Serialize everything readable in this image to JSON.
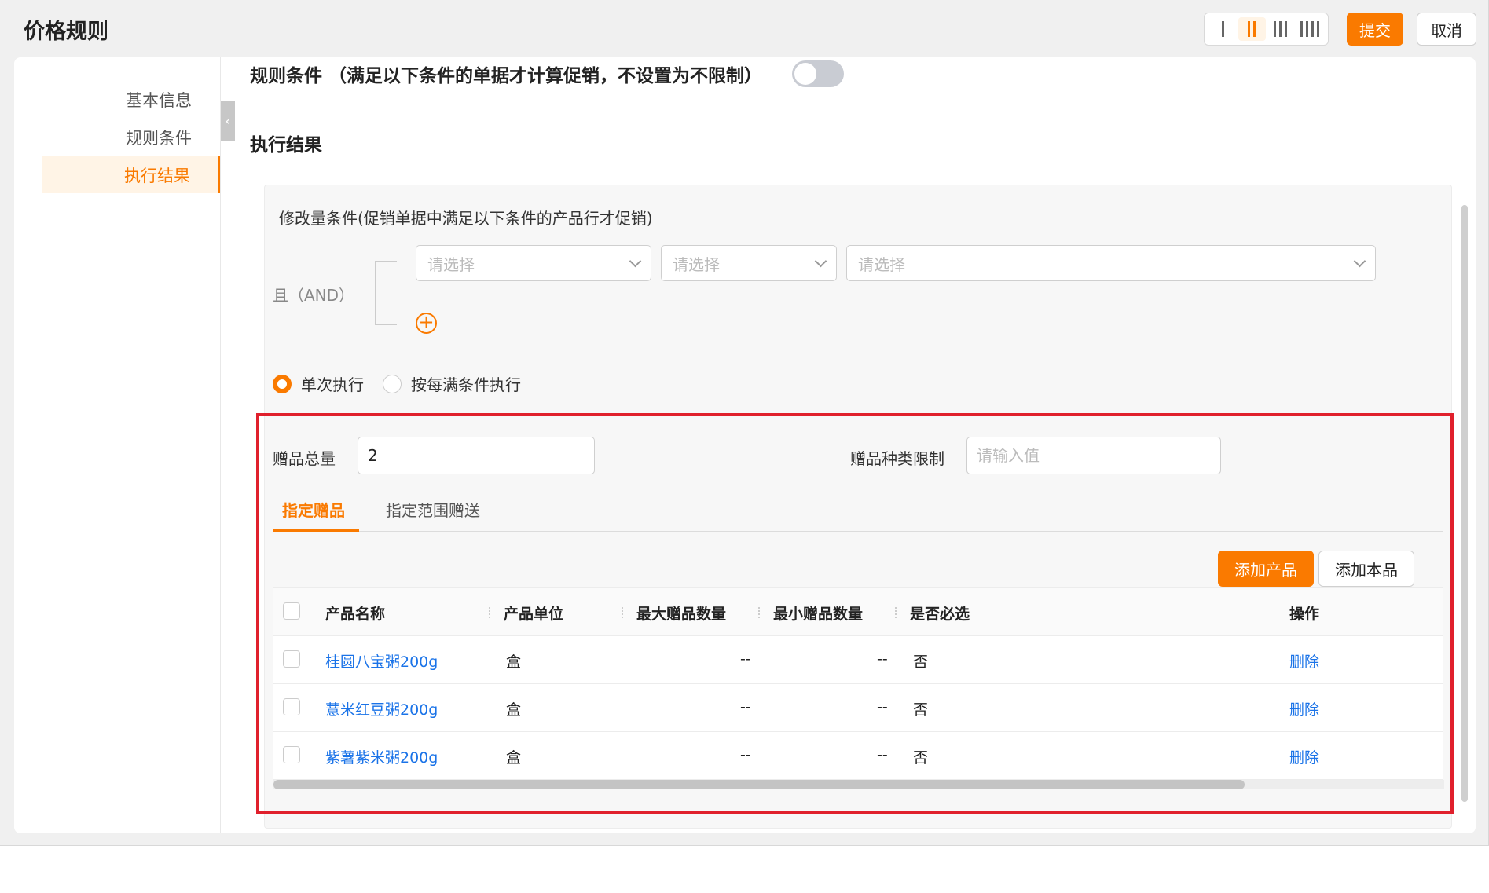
{
  "header": {
    "title": "价格规则",
    "submit_label": "提交",
    "cancel_label": "取消",
    "layout_options": [
      "1-column",
      "2-column",
      "3-column",
      "4-column"
    ],
    "layout_selected": "2-column",
    "accent": "#fa7a00"
  },
  "sidebar": {
    "items": [
      {
        "label": "基本信息",
        "active": false
      },
      {
        "label": "规则条件",
        "active": false
      },
      {
        "label": "执行结果",
        "active": true
      }
    ]
  },
  "sections": {
    "rule_condition_title": "规则条件 （满足以下条件的单据才计算促销，不设置为不限制）",
    "rule_condition_toggle": false,
    "exec_result_title": "执行结果"
  },
  "modify_condition": {
    "caption": "修改量条件(促销单据中满足以下条件的产品行才促销)",
    "and_label": "且（AND）",
    "selects": [
      {
        "placeholder": "请选择"
      },
      {
        "placeholder": "请选择"
      },
      {
        "placeholder": "请选择"
      }
    ]
  },
  "execution": {
    "options": [
      {
        "label": "单次执行",
        "checked": true
      },
      {
        "label": "按每满条件执行",
        "checked": false
      }
    ]
  },
  "gift": {
    "total_label": "赠品总量",
    "total_value": "2",
    "type_limit_label": "赠品种类限制",
    "type_limit_placeholder": "请输入值",
    "tabs": [
      {
        "label": "指定赠品",
        "active": true
      },
      {
        "label": "指定范围赠送",
        "active": false
      }
    ],
    "add_product_label": "添加产品",
    "add_self_label": "添加本品"
  },
  "table": {
    "columns": [
      "产品名称",
      "产品单位",
      "最大赠品数量",
      "最小赠品数量",
      "是否必选",
      "操作"
    ],
    "rows": [
      {
        "name": "桂圆八宝粥200g",
        "unit": "盒",
        "max": "--",
        "min": "--",
        "required": "否",
        "action": "删除"
      },
      {
        "name": "薏米红豆粥200g",
        "unit": "盒",
        "max": "--",
        "min": "--",
        "required": "否",
        "action": "删除"
      },
      {
        "name": "紫薯紫米粥200g",
        "unit": "盒",
        "max": "--",
        "min": "--",
        "required": "否",
        "action": "删除"
      }
    ]
  },
  "annotation_color": "#e0202c"
}
